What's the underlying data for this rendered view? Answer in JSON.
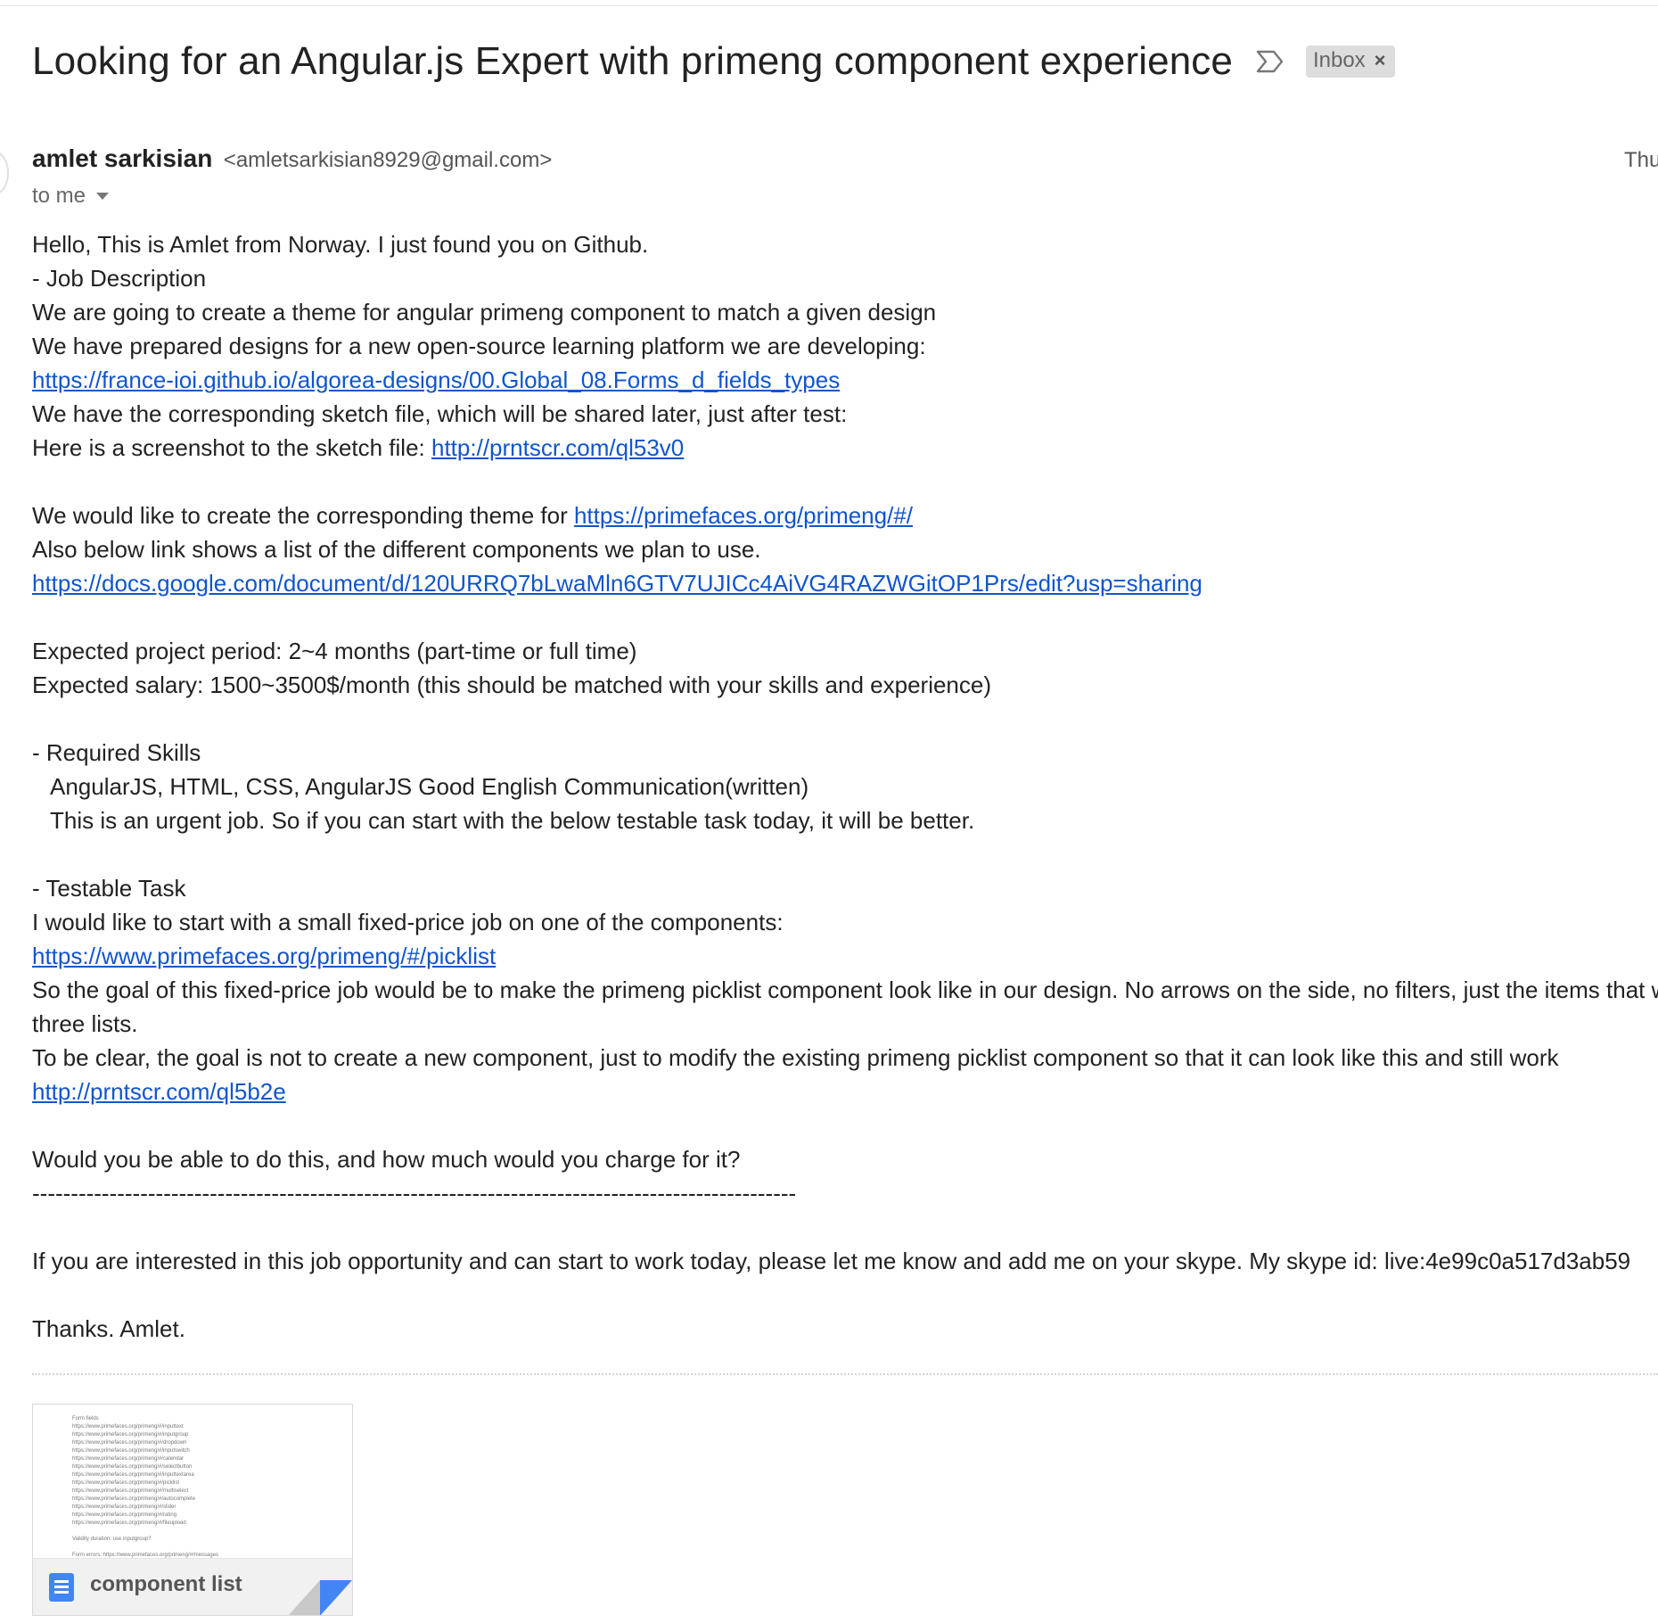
{
  "email": {
    "subject": "Looking for an Angular.js Expert with primeng component experience",
    "label": "Inbox",
    "label_close": "×",
    "sender_name": "amlet sarkisian",
    "sender_email": "<amletsarkisian8929@gmail.com>",
    "date": "Thu",
    "to": "to me"
  },
  "body": {
    "l01": "Hello, This is Amlet from Norway. I just found you on Github.",
    "l02": "- Job Description",
    "l03": "We are going to create a theme for angular primeng component to match a given design",
    "l04": "We have prepared designs for a new open-source learning platform we are developing:",
    "l05_link": "https://france-ioi.github.io/algorea-designs/00.Global_08.Forms_d_fields_types",
    "l06": "We have the corresponding sketch file, which will be shared later, just after test:",
    "l07_text": "Here is a screenshot to the sketch file: ",
    "l07_link": "http://prntscr.com/ql53v0",
    "l09_text": "We would like to create the corresponding theme for ",
    "l09_link": "https://primefaces.org/primeng/#/",
    "l10": "Also below link shows a list of the different components we plan to use.",
    "l11_link": "https://docs.google.com/document/d/120URRQ7bLwaMln6GTV7UJICc4AiVG4RAZWGitOP1Prs/edit?usp=sharing",
    "l13": "Expected project period: 2~4 months (part-time or full time)",
    "l14": "Expected salary: 1500~3500$/month (this should be matched with your skills and experience)",
    "l16": "- Required Skills",
    "l17": "AngularJS, HTML, CSS, AngularJS   Good English Communication(written)",
    "l18": "This is an urgent job. So if you can start with the below testable task today, it will be better.",
    "l20": "- Testable Task",
    "l21": "I would like to start with a small fixed-price job on one of the components:",
    "l22_link": "https://www.primefaces.org/primeng/#/picklist",
    "l23": "So the goal of this fixed-price job would be to make the primeng picklist component look like in our design. No arrows on the side, no filters, just the items that w",
    "l24": "three lists.",
    "l25": "To be clear, the goal is not to create a new component, just to modify the existing primeng picklist component so that it can look like this and still work",
    "l26_link": "http://prntscr.com/ql5b2e",
    "l28": "Would you be able to do this, and how much would you charge for it?",
    "l29": "---------------------------------------------------------------------------------------------------",
    "l31": "If you are interested in this job opportunity and can start to work today, please let me know and add me on your skype. My skype id: live:4e99c0a517d3ab59",
    "l33": "Thanks. Amlet."
  },
  "attachment": {
    "name": "component list",
    "icon": "google-docs-icon",
    "preview_title": "Form fields",
    "preview_lines": [
      "https://www.primefaces.org/primeng/#/inputtext",
      "https://www.primefaces.org/primeng/#/inputgroup",
      "https://www.primefaces.org/primeng/#/dropdown",
      "https://www.primefaces.org/primeng/#/inputswitch",
      "https://www.primefaces.org/primeng/#/calendar",
      "https://www.primefaces.org/primeng/#/selectbutton",
      "https://www.primefaces.org/primeng/#/inputtextarea",
      "https://www.primefaces.org/primeng/#/picklist",
      "https://www.primefaces.org/primeng/#/multiselect",
      "https://www.primefaces.org/primeng/#/autocomplete",
      "https://www.primefaces.org/primeng/#/slider",
      "https://www.primefaces.org/primeng/#/rating",
      "https://www.primefaces.org/primeng/#/fileupload"
    ],
    "preview_note1": "Validity duration: use inputgroup?",
    "preview_note2": "Form errors: https://www.primefaces.org/primeng/#/messages"
  },
  "colors": {
    "link": "#1155cc",
    "label_bg": "#dddddd",
    "doc_blue": "#4285f4"
  }
}
